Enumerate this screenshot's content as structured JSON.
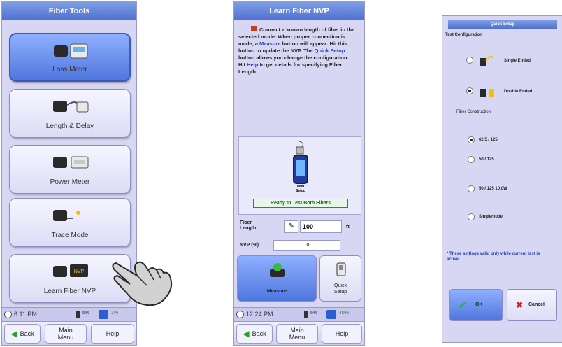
{
  "panel1": {
    "title": "Fiber Tools",
    "tools": [
      {
        "label": "Loss Meter",
        "icon": "loss-meter-icon"
      },
      {
        "label": "Length & Delay",
        "icon": "length-delay-icon"
      },
      {
        "label": "Power Meter",
        "icon": "power-meter-icon"
      },
      {
        "label": "Trace Mode",
        "icon": "trace-mode-icon"
      },
      {
        "label": "Learn Fiber NVP",
        "icon": "learn-nvp-icon"
      }
    ],
    "status": {
      "time": "6:11 PM",
      "battery": "6%",
      "disk": "1%"
    },
    "bottom": {
      "back": "Back",
      "main_line1": "Main",
      "main_line2": "Menu",
      "help": "Help"
    }
  },
  "panel2": {
    "title": "Learn Fiber NVP",
    "instr": {
      "p1": "Connect a known length of fiber in the selected mode. When proper connection is made, a",
      "measure": "Measure",
      "p2": "button will appear. Hit this button to update the NVP. The",
      "quick": "Quick Setup",
      "p3": "button allows you change the configuration.",
      "hit": "Hit",
      "help": "Help",
      "p4": "to get details for specifying Fiber Length."
    },
    "device_label_1": "Mini",
    "device_label_2": "Setup",
    "ready": "Ready to Test Both Fibers",
    "fiber_length_label_1": "Fiber",
    "fiber_length_label_2": "Length",
    "fiber_length_value": "100",
    "fiber_length_unit": "ft",
    "nvp_label": "NVP (%)",
    "nvp_value": "0",
    "measure_button": "Measure",
    "quick_setup_1": "Quick",
    "quick_setup_2": "Setup",
    "status": {
      "time": "12:24 PM",
      "battery": "6%",
      "disk": "40%"
    },
    "bottom": {
      "back": "Back",
      "main_line1": "Main",
      "main_line2": "Menu",
      "help": "Help"
    }
  },
  "panel3": {
    "title": "Quick Setup",
    "test_config": "Test Configuration",
    "single": "Single Ended",
    "double": "Double Ended",
    "fiber_construction": "Fiber Construction",
    "options": [
      "62.5 / 125",
      "50 / 125",
      "50 / 125 10.0W",
      "Singlemode"
    ],
    "note": "* These settings valid only while current test is active.",
    "ok": "OK",
    "cancel": "Cancel"
  },
  "colors": {
    "screen": "#d7d7f3",
    "title": "#4f70cf",
    "highlight": "#2740b8"
  }
}
